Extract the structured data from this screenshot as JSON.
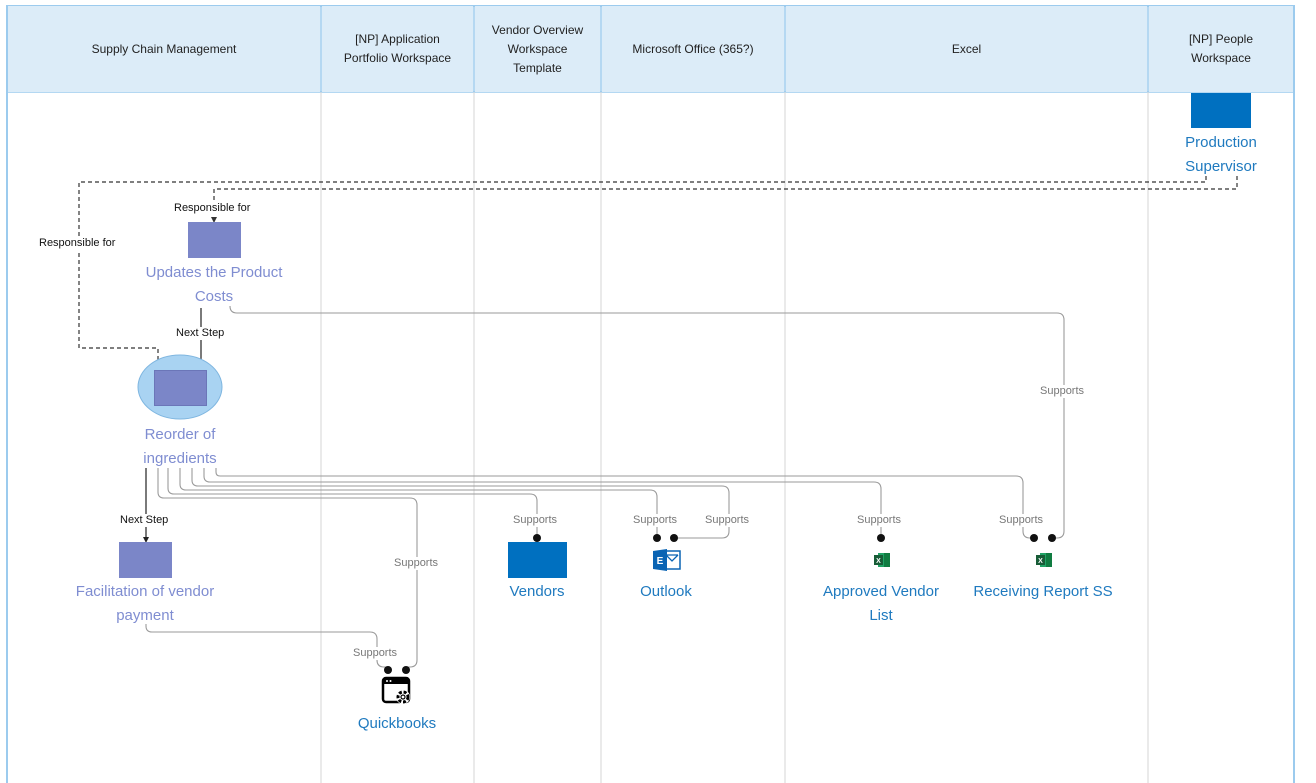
{
  "lanes": [
    {
      "title": "Supply Chain Management"
    },
    {
      "title": "[NP] Application\nPortfolio Workspace"
    },
    {
      "title": "Vendor Overview\nWorkspace\nTemplate"
    },
    {
      "title": "Microsoft Office (365?)"
    },
    {
      "title": "Excel"
    },
    {
      "title": "[NP] People\nWorkspace"
    }
  ],
  "nodes": {
    "production_supervisor": {
      "label": "Production\nSupervisor",
      "color": "#0070c0"
    },
    "updates_product_costs": {
      "label": "Updates the Product\nCosts",
      "color": "#7b86c8"
    },
    "reorder_ingredients": {
      "label": "Reorder of\ningredients",
      "color": "#7b86c8",
      "highlight": "#a9d3f2"
    },
    "facilitation_vendor_payment": {
      "label": "Facilitation of vendor\npayment",
      "color": "#7b86c8"
    },
    "vendors": {
      "label": "Vendors",
      "color": "#0070c0"
    },
    "outlook": {
      "label": "Outlook",
      "icon": "outlook-icon"
    },
    "approved_vendor_list": {
      "label": "Approved Vendor\nList",
      "icon": "excel-icon"
    },
    "receiving_report_ss": {
      "label": "Receiving Report SS",
      "icon": "excel-icon"
    },
    "quickbooks": {
      "label": "Quickbooks",
      "icon": "app-settings-icon"
    }
  },
  "edge_labels": {
    "responsible_for_1": "Responsible for",
    "responsible_for_2": "Responsible for",
    "next_step_1": "Next Step",
    "next_step_2": "Next Step",
    "supports_receiving_long": "Supports",
    "supports_vendors": "Supports",
    "supports_outlook_1": "Supports",
    "supports_outlook_2": "Supports",
    "supports_approved": "Supports",
    "supports_receiving": "Supports",
    "supports_qb_1": "Supports",
    "supports_qb_2": "Supports"
  }
}
